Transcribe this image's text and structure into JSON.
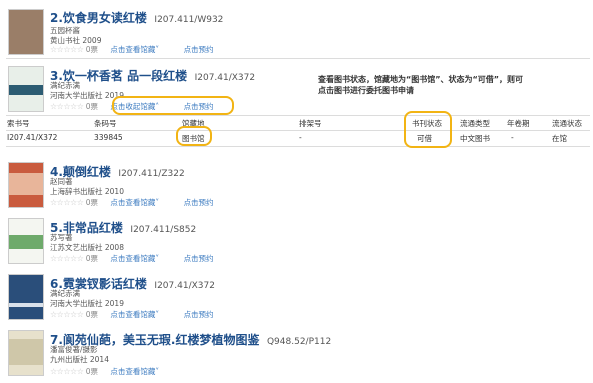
{
  "books": [
    {
      "title": "2.饮食男女读红楼",
      "call_no": "I207.411/W932",
      "author": "五园杯酱",
      "publisher": "黄山书社",
      "year": "2009",
      "votes": "0票",
      "link_view": "点击查看馆藏",
      "link_reserve": "点击预约",
      "cover_color": "#9a7e68"
    },
    {
      "title": "3.饮一杯香茗 品一段红楼",
      "call_no": "I207.41/X372",
      "author": "满纪赤满",
      "publisher": "河南大学出版社",
      "year": "2019",
      "votes": "0票",
      "link_view": "点击收起馆藏",
      "link_reserve": "点击预约",
      "cover_color": "#2c5c73"
    },
    {
      "title": "4.颠倒红楼",
      "call_no": "I207.411/Z322",
      "author": "赵同著",
      "publisher": "上海辞书出版社",
      "year": "2010",
      "votes": "0票",
      "link_view": "点击查看馆藏",
      "link_reserve": "点击预约",
      "cover_color": "#c95b3e"
    },
    {
      "title": "5.非常品红楼",
      "call_no": "I207.411/S852",
      "author": "苏写著",
      "publisher": "江苏文艺出版社",
      "year": "2008",
      "votes": "0票",
      "link_view": "点击查看馆藏",
      "link_reserve": "点击预约",
      "cover_color": "#6eaa6b"
    },
    {
      "title": "6.霓裳钗影话红楼",
      "call_no": "I207.41/X372",
      "author": "满纪赤满",
      "publisher": "河南大学出版社",
      "year": "2019",
      "votes": "0票",
      "link_view": "点击查看馆藏",
      "link_reserve": "点击预约",
      "cover_color": "#2a4e7a"
    },
    {
      "title": "7.阆苑仙葩，美玉无瑕.红楼梦植物图鉴",
      "call_no": "Q948.52/P112",
      "author": "潘富俊著/摄影",
      "publisher": "九州出版社",
      "year": "2014",
      "votes": "0票",
      "link_view": "点击查看馆藏",
      "link_reserve": "",
      "cover_color": "#e7e1cc"
    }
  ],
  "holdings": {
    "headers": [
      "索书号",
      "条码号",
      "馆藏地",
      "排架号",
      "书刊状态",
      "流通类型",
      "年卷期",
      "流通状态"
    ],
    "row": [
      "I207.41/X372",
      "339845",
      "图书馆",
      "-",
      "可借",
      "中文图书",
      "-",
      "在馆"
    ]
  },
  "note": "查看图书状态，馆藏地为“图书馆”、状态为“可借”，则可点击图书进行委托图书申请",
  "stars": "☆☆☆☆☆",
  "highlight_color": "#f2b414"
}
